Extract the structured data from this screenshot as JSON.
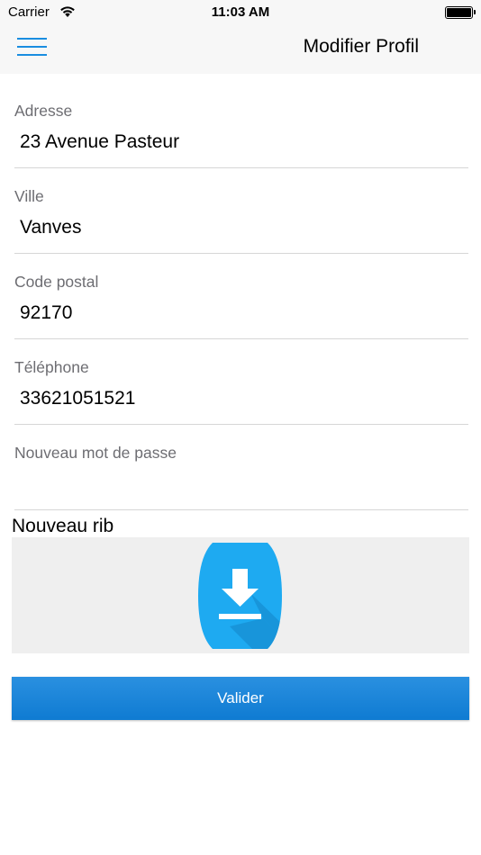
{
  "status_bar": {
    "carrier": "Carrier",
    "time": "11:03 AM",
    "wifi_icon": "wifi-icon",
    "battery_icon": "battery-icon"
  },
  "nav": {
    "title": "Modifier Profil",
    "menu_icon": "hamburger-menu-icon"
  },
  "form": {
    "fields": [
      {
        "label": "Adresse",
        "value": "23 Avenue Pasteur"
      },
      {
        "label": "Ville",
        "value": "Vanves"
      },
      {
        "label": "Code postal",
        "value": "92170"
      },
      {
        "label": "Téléphone",
        "value": "33621051521"
      },
      {
        "label": "Nouveau mot de passe",
        "value": ""
      }
    ],
    "rib_label": "Nouveau rib",
    "rib_icon": "download-icon",
    "submit_label": "Valider"
  },
  "colors": {
    "accent": "#1a8de0",
    "button": "#1480d6",
    "icon_blue": "#1eaaf1"
  }
}
